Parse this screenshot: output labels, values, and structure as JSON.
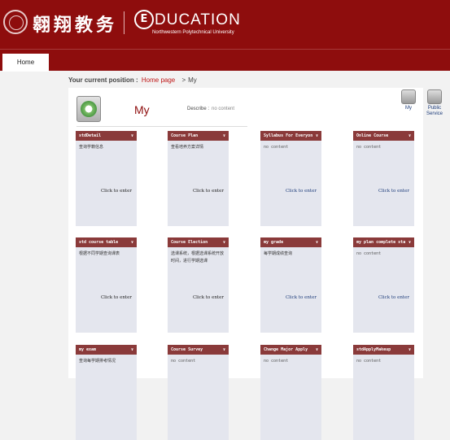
{
  "header": {
    "cn_logo": "翱翔教务",
    "edu_e": "E",
    "edu_word": "DUCATION",
    "edu_sub": "Northwestern Polytechnical University"
  },
  "nav": {
    "home": "Home"
  },
  "breadcrumb": {
    "label": "Your current position :",
    "home": "Home page",
    "sep": ">",
    "current": "My"
  },
  "page": {
    "title": "My",
    "describe_label": "Describe :",
    "describe_value": "no content"
  },
  "side": [
    {
      "label": "My"
    },
    {
      "label": "Public Service"
    }
  ],
  "cards": [
    {
      "title": "stdDetail",
      "desc": "查询学籍信息",
      "enter": "Click to enter",
      "blue": false
    },
    {
      "title": "Course Plan",
      "desc": "查看培养方案详情",
      "enter": "Click to enter",
      "blue": false
    },
    {
      "title": "Syllabus For Everyone",
      "desc": "no content",
      "enter": "Click to enter",
      "blue": true
    },
    {
      "title": "Online Course",
      "desc": "no content",
      "enter": "Click to enter",
      "blue": true
    },
    {
      "title": "std course table",
      "desc": "根据不同学期查询课表",
      "enter": "Click to enter",
      "blue": false
    },
    {
      "title": "Course Election",
      "desc": "选课系统，根据选课系统开放时间，进行学期选课",
      "enter": "Click to enter",
      "blue": false
    },
    {
      "title": "my grade",
      "desc": "每学期成绩查询",
      "enter": "Click to enter",
      "blue": true
    },
    {
      "title": "my plan complete status",
      "desc": "no content",
      "enter": "Click to enter",
      "blue": true
    },
    {
      "title": "my exam",
      "desc": "查询每学期排考情况",
      "enter": "",
      "blue": false
    },
    {
      "title": "Course Survey",
      "desc": "no content",
      "enter": "",
      "blue": false
    },
    {
      "title": "Change Major Apply",
      "desc": "no content",
      "enter": "",
      "blue": false
    },
    {
      "title": "stdApplyMakeup",
      "desc": "no content",
      "enter": "",
      "blue": false
    }
  ]
}
